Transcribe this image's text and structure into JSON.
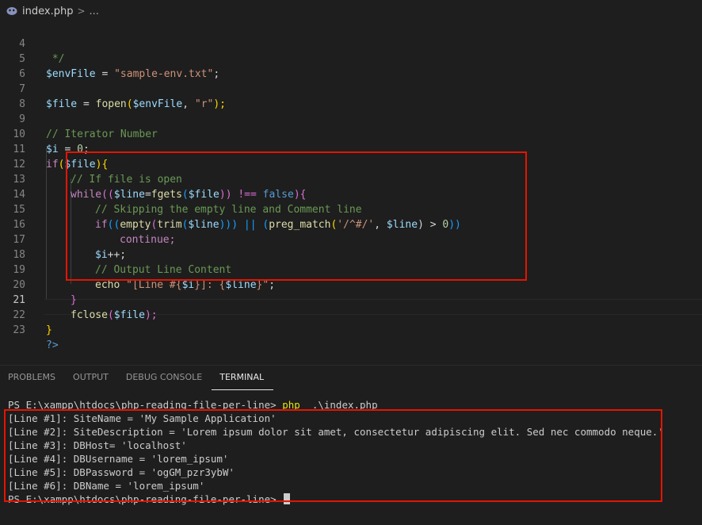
{
  "breadcrumb": {
    "file": "index.php",
    "separator": ">",
    "more": "..."
  },
  "editor": {
    "active_line": "21",
    "line_numbers": [
      "4",
      "5",
      "6",
      "7",
      "8",
      "9",
      "10",
      "11",
      "12",
      "13",
      "14",
      "15",
      "16",
      "17",
      "18",
      "19",
      "20",
      "21",
      "22",
      "23"
    ],
    "code": {
      "l4": " */",
      "l5": [
        "$envFile",
        " = ",
        "\"sample-env.txt\"",
        ";"
      ],
      "l7": [
        "$file",
        " = ",
        "fopen",
        "(",
        "$envFile",
        ", ",
        "\"r\"",
        ");"
      ],
      "l9": "// Iterator Number",
      "l10": [
        "$i",
        " = ",
        "0",
        ";"
      ],
      "l11": [
        "if",
        "(",
        "$file",
        ")",
        "{"
      ],
      "l12": "// If file is open",
      "l13": [
        "while",
        "((",
        "$line",
        "=",
        "fgets",
        "(",
        "$file",
        ")) !== ",
        "false",
        ")",
        "{"
      ],
      "l14": "// Skipping the empty line and Comment line",
      "l15": [
        "if",
        "((",
        "empty",
        "(",
        "trim",
        "(",
        "$line",
        "))) || (",
        "preg_match",
        "(",
        "'/^#/'",
        ", ",
        "$line",
        ") > ",
        "0",
        "))"
      ],
      "l16": "continue;",
      "l17": [
        "$i",
        "++;"
      ],
      "l18": "// Output Line Content",
      "l19": [
        "echo",
        " ",
        "\"[Line #{",
        "$i",
        "}]: {",
        "$line",
        "}\"",
        ";"
      ],
      "l20": "}",
      "l21": [
        "fclose",
        "(",
        "$file",
        ");"
      ],
      "l22": "}",
      "l23": "?>"
    }
  },
  "panel": {
    "tabs": [
      {
        "label": "PROBLEMS",
        "active": false
      },
      {
        "label": "OUTPUT",
        "active": false
      },
      {
        "label": "DEBUG CONSOLE",
        "active": false
      },
      {
        "label": "TERMINAL",
        "active": true
      }
    ]
  },
  "terminal": {
    "prompt": "PS E:\\xampp\\htdocs\\php-reading-file-per-line>",
    "command": "php",
    "command_arg": ".\\index.php",
    "output": [
      "[Line #1]: SiteName = 'My Sample Application'",
      "[Line #2]: SiteDescription = 'Lorem ipsum dolor sit amet, consectetur adipiscing elit. Sed nec commodo neque.'",
      "[Line #3]: DBHost= 'localhost'",
      "[Line #4]: DBUsername = 'lorem_ipsum'",
      "[Line #5]: DBPassword = 'ogGM_pzr3ybW'",
      "[Line #6]: DBName = 'lorem_ipsum'"
    ],
    "final_prompt": "PS E:\\xampp\\htdocs\\php-reading-file-per-line>"
  },
  "colors": {
    "highlight_box": "#e51400",
    "background": "#1e1e1e",
    "php_icon": "#8892bf"
  }
}
